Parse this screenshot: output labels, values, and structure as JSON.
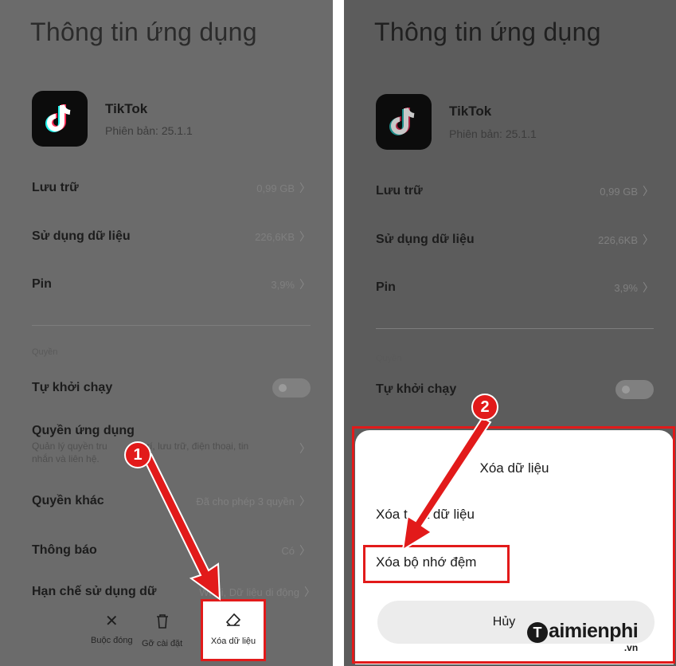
{
  "left": {
    "title": "Thông tin ứng dụng",
    "app": {
      "name": "TikTok",
      "version": "Phiên bản: 25.1.1",
      "icon": "tiktok-icon"
    },
    "rows": [
      {
        "label": "Lưu trữ",
        "value": "0,99 GB"
      },
      {
        "label": "Sử dụng dữ liệu",
        "value": "226,6KB"
      },
      {
        "label": "Pin",
        "value": "3,9%"
      }
    ],
    "section_label": "Quyền",
    "autostart_label": "Tự khởi chạy",
    "permissions_label": "Quyền ứng dụng",
    "permissions_sub_1": "Quản lý quyền tru",
    "permissions_sub_2": "vị trí, lưu trữ, điện thoại, tin",
    "permissions_sub_3": "nhắn và liên hệ.",
    "other_label": "Quyền khác",
    "other_value": "Đã cho phép 3 quyền",
    "notif_label": "Thông báo",
    "notif_value": "Có",
    "restrict_label": "Hạn chế sử dụng dữ",
    "restrict_value": "Wi-Fi, Dữ liệu di động",
    "bottom": {
      "force_stop": "Buộc đóng",
      "uninstall": "Gỡ cài đặt",
      "clear_data": "Xóa dữ liệu"
    },
    "badge": "1"
  },
  "right": {
    "title": "Thông tin ứng dụng",
    "app": {
      "name": "TikTok",
      "version": "Phiên bản: 25.1.1"
    },
    "rows": [
      {
        "label": "Lưu trữ",
        "value": "0,99 GB"
      },
      {
        "label": "Sử dụng dữ liệu",
        "value": "226,6KB"
      },
      {
        "label": "Pin",
        "value": "3,9%"
      }
    ],
    "section_label": "Quyền",
    "autostart_label": "Tự khởi chạy",
    "badge": "2",
    "sheet": {
      "title": "Xóa dữ liệu",
      "option_all_a": "Xóa t",
      "option_all_b": "ả dữ liệu",
      "option_cache": "Xóa bộ nhớ đệm",
      "cancel_a": "Hủy"
    }
  },
  "watermark": {
    "brand": "aimienphi",
    "suffix": ".vn",
    "initial": "T"
  },
  "colors": {
    "highlight": "#e21a1a",
    "dim_panel": "#6b6b6b",
    "sheet_bg": "#ffffff"
  }
}
